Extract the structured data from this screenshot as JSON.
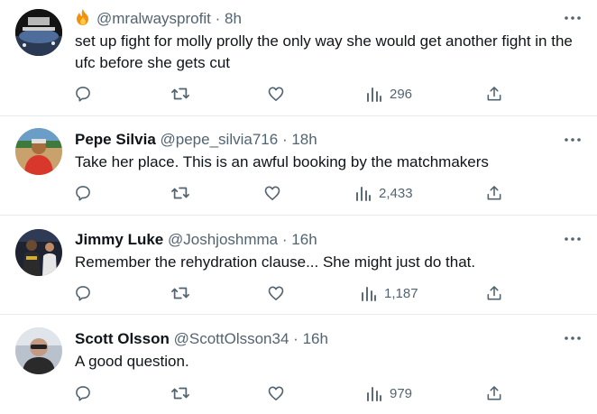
{
  "tweets": [
    {
      "name": "",
      "emoji": "fire",
      "handle": "@mralwaysprofit",
      "sep": "·",
      "time": "8h",
      "text": "set up fight for molly prolly the only way she would get another fight in the ufc before she gets cut",
      "views": "296"
    },
    {
      "name": "Pepe Silvia",
      "handle": "@pepe_silvia716",
      "sep": "·",
      "time": "18h",
      "text": "Take her place. This is an awful booking by the matchmakers",
      "views": "2,433"
    },
    {
      "name": "Jimmy Luke",
      "handle": "@Joshjoshmma",
      "sep": "·",
      "time": "16h",
      "text": "Remember the rehydration clause... She might just do that.",
      "views": "1,187"
    },
    {
      "name": "Scott Olsson",
      "handle": "@ScottOlsson34",
      "sep": "·",
      "time": "16h",
      "text": "A good question.",
      "views": "979"
    }
  ],
  "icons": {
    "reply": "reply-icon",
    "retweet": "retweet-icon",
    "like": "like-icon",
    "views": "views-icon",
    "share": "share-icon",
    "more": "more-icon"
  },
  "colors": {
    "text": "#0f1419",
    "muted": "#536471",
    "divider": "#e7e9ea"
  }
}
